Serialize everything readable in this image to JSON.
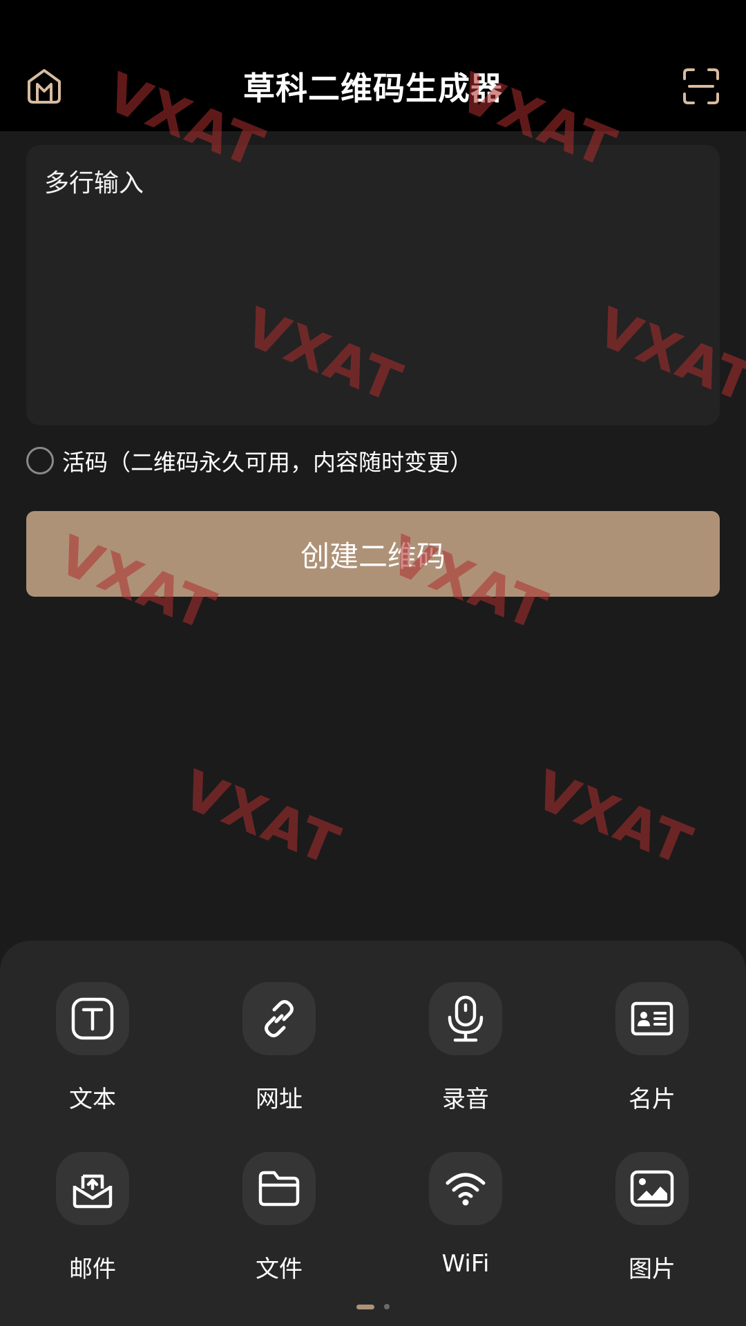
{
  "header": {
    "title": "草科二维码生成器",
    "home_icon": "home-icon",
    "scan_icon": "scan-icon"
  },
  "input": {
    "placeholder": "多行输入",
    "value": ""
  },
  "live_code": {
    "label": "活码（二维码永久可用，内容随时变更）",
    "checked": false
  },
  "create_button": {
    "label": "创建二维码"
  },
  "types": [
    {
      "label": "文本",
      "icon": "text-icon"
    },
    {
      "label": "网址",
      "icon": "link-icon"
    },
    {
      "label": "录音",
      "icon": "microphone-icon"
    },
    {
      "label": "名片",
      "icon": "contact-card-icon"
    },
    {
      "label": "邮件",
      "icon": "mail-icon"
    },
    {
      "label": "文件",
      "icon": "folder-icon"
    },
    {
      "label": "WiFi",
      "icon": "wifi-icon"
    },
    {
      "label": "图片",
      "icon": "image-icon"
    }
  ],
  "pager": {
    "page": 1,
    "pages": 2
  },
  "colors": {
    "accent": "#ae9278",
    "background": "#1b1b1b",
    "header": "#000000"
  },
  "watermark": "VXAT"
}
